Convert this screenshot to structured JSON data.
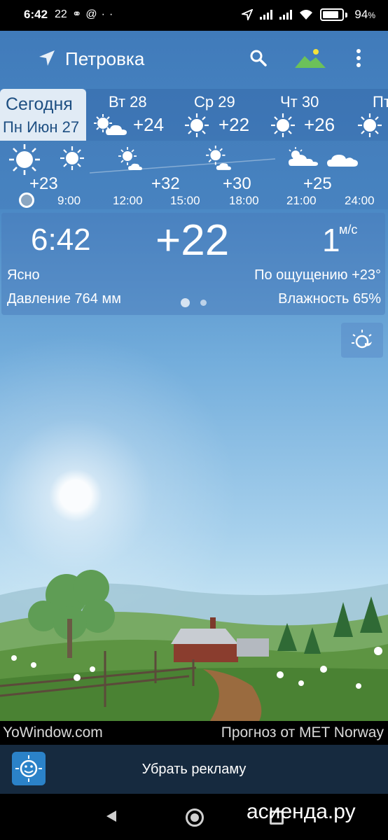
{
  "status_bar": {
    "time": "6:42",
    "temp_indicator": "22",
    "battery": "94"
  },
  "app_bar": {
    "location": "Петровка"
  },
  "days": {
    "today": {
      "label": "Сегодня",
      "date": "Пн Июн 27"
    },
    "forecast": [
      {
        "name": "Вт 28",
        "temp": "+24",
        "icon": "sun-cloud-icon"
      },
      {
        "name": "Ср 29",
        "temp": "+22",
        "icon": "sun-icon"
      },
      {
        "name": "Чт 30",
        "temp": "+26",
        "icon": "sun-icon"
      },
      {
        "name": "Пт",
        "temp": "",
        "icon": "sun-icon"
      }
    ]
  },
  "hourly": {
    "temps": [
      "+23",
      "+32",
      "+30",
      "+25"
    ],
    "times": [
      "9:00",
      "12:00",
      "15:00",
      "18:00",
      "21:00",
      "24:00"
    ]
  },
  "current": {
    "time": "6:42",
    "temp": "+22",
    "wind": "1",
    "wind_unit": "м/с",
    "condition": "Ясно",
    "feels_like": "По ощущению +23°",
    "pressure": "Давление 764 мм",
    "humidity": "Влажность 65%"
  },
  "footer": {
    "brand": "YoWindow.com",
    "provider": "Прогноз от MET Norway",
    "ad_label": "Убрать рекламу"
  },
  "watermark": "асиенда.ру",
  "colors": {
    "sky_top": "#3e78b8",
    "today_tab_bg": "#e1ebf5",
    "today_tab_text": "#1e4f82",
    "ad_bar": "#162a3f"
  }
}
